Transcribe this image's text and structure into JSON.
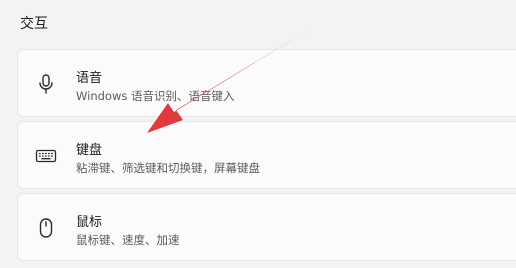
{
  "section": {
    "title": "交互"
  },
  "items": [
    {
      "title": "语音",
      "description": "Windows 语音识别、语音键入",
      "icon": "microphone-icon"
    },
    {
      "title": "键盘",
      "description": "粘滞键、筛选键和切换键，屏幕键盘",
      "icon": "keyboard-icon"
    },
    {
      "title": "鼠标",
      "description": "鼠标键、速度、加速",
      "icon": "mouse-icon"
    }
  ],
  "annotation": {
    "arrow_color": "#e03a3e"
  }
}
